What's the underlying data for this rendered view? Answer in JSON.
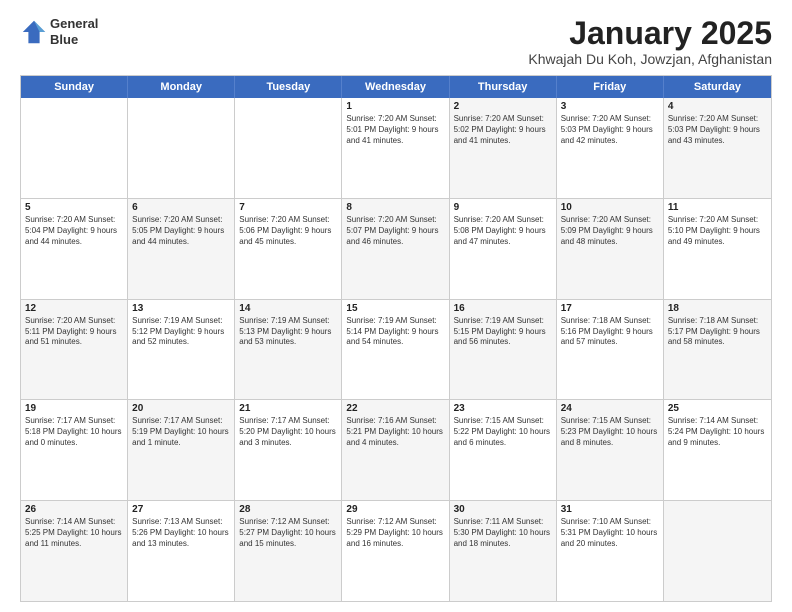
{
  "header": {
    "logo_line1": "General",
    "logo_line2": "Blue",
    "month_title": "January 2025",
    "location": "Khwajah Du Koh, Jowzjan, Afghanistan"
  },
  "days_of_week": [
    "Sunday",
    "Monday",
    "Tuesday",
    "Wednesday",
    "Thursday",
    "Friday",
    "Saturday"
  ],
  "weeks": [
    [
      {
        "day": "",
        "info": "",
        "shaded": false
      },
      {
        "day": "",
        "info": "",
        "shaded": false
      },
      {
        "day": "",
        "info": "",
        "shaded": false
      },
      {
        "day": "1",
        "info": "Sunrise: 7:20 AM\nSunset: 5:01 PM\nDaylight: 9 hours and 41 minutes.",
        "shaded": false
      },
      {
        "day": "2",
        "info": "Sunrise: 7:20 AM\nSunset: 5:02 PM\nDaylight: 9 hours and 41 minutes.",
        "shaded": true
      },
      {
        "day": "3",
        "info": "Sunrise: 7:20 AM\nSunset: 5:03 PM\nDaylight: 9 hours and 42 minutes.",
        "shaded": false
      },
      {
        "day": "4",
        "info": "Sunrise: 7:20 AM\nSunset: 5:03 PM\nDaylight: 9 hours and 43 minutes.",
        "shaded": true
      }
    ],
    [
      {
        "day": "5",
        "info": "Sunrise: 7:20 AM\nSunset: 5:04 PM\nDaylight: 9 hours and 44 minutes.",
        "shaded": false
      },
      {
        "day": "6",
        "info": "Sunrise: 7:20 AM\nSunset: 5:05 PM\nDaylight: 9 hours and 44 minutes.",
        "shaded": true
      },
      {
        "day": "7",
        "info": "Sunrise: 7:20 AM\nSunset: 5:06 PM\nDaylight: 9 hours and 45 minutes.",
        "shaded": false
      },
      {
        "day": "8",
        "info": "Sunrise: 7:20 AM\nSunset: 5:07 PM\nDaylight: 9 hours and 46 minutes.",
        "shaded": true
      },
      {
        "day": "9",
        "info": "Sunrise: 7:20 AM\nSunset: 5:08 PM\nDaylight: 9 hours and 47 minutes.",
        "shaded": false
      },
      {
        "day": "10",
        "info": "Sunrise: 7:20 AM\nSunset: 5:09 PM\nDaylight: 9 hours and 48 minutes.",
        "shaded": true
      },
      {
        "day": "11",
        "info": "Sunrise: 7:20 AM\nSunset: 5:10 PM\nDaylight: 9 hours and 49 minutes.",
        "shaded": false
      }
    ],
    [
      {
        "day": "12",
        "info": "Sunrise: 7:20 AM\nSunset: 5:11 PM\nDaylight: 9 hours and 51 minutes.",
        "shaded": true
      },
      {
        "day": "13",
        "info": "Sunrise: 7:19 AM\nSunset: 5:12 PM\nDaylight: 9 hours and 52 minutes.",
        "shaded": false
      },
      {
        "day": "14",
        "info": "Sunrise: 7:19 AM\nSunset: 5:13 PM\nDaylight: 9 hours and 53 minutes.",
        "shaded": true
      },
      {
        "day": "15",
        "info": "Sunrise: 7:19 AM\nSunset: 5:14 PM\nDaylight: 9 hours and 54 minutes.",
        "shaded": false
      },
      {
        "day": "16",
        "info": "Sunrise: 7:19 AM\nSunset: 5:15 PM\nDaylight: 9 hours and 56 minutes.",
        "shaded": true
      },
      {
        "day": "17",
        "info": "Sunrise: 7:18 AM\nSunset: 5:16 PM\nDaylight: 9 hours and 57 minutes.",
        "shaded": false
      },
      {
        "day": "18",
        "info": "Sunrise: 7:18 AM\nSunset: 5:17 PM\nDaylight: 9 hours and 58 minutes.",
        "shaded": true
      }
    ],
    [
      {
        "day": "19",
        "info": "Sunrise: 7:17 AM\nSunset: 5:18 PM\nDaylight: 10 hours and 0 minutes.",
        "shaded": false
      },
      {
        "day": "20",
        "info": "Sunrise: 7:17 AM\nSunset: 5:19 PM\nDaylight: 10 hours and 1 minute.",
        "shaded": true
      },
      {
        "day": "21",
        "info": "Sunrise: 7:17 AM\nSunset: 5:20 PM\nDaylight: 10 hours and 3 minutes.",
        "shaded": false
      },
      {
        "day": "22",
        "info": "Sunrise: 7:16 AM\nSunset: 5:21 PM\nDaylight: 10 hours and 4 minutes.",
        "shaded": true
      },
      {
        "day": "23",
        "info": "Sunrise: 7:15 AM\nSunset: 5:22 PM\nDaylight: 10 hours and 6 minutes.",
        "shaded": false
      },
      {
        "day": "24",
        "info": "Sunrise: 7:15 AM\nSunset: 5:23 PM\nDaylight: 10 hours and 8 minutes.",
        "shaded": true
      },
      {
        "day": "25",
        "info": "Sunrise: 7:14 AM\nSunset: 5:24 PM\nDaylight: 10 hours and 9 minutes.",
        "shaded": false
      }
    ],
    [
      {
        "day": "26",
        "info": "Sunrise: 7:14 AM\nSunset: 5:25 PM\nDaylight: 10 hours and 11 minutes.",
        "shaded": true
      },
      {
        "day": "27",
        "info": "Sunrise: 7:13 AM\nSunset: 5:26 PM\nDaylight: 10 hours and 13 minutes.",
        "shaded": false
      },
      {
        "day": "28",
        "info": "Sunrise: 7:12 AM\nSunset: 5:27 PM\nDaylight: 10 hours and 15 minutes.",
        "shaded": true
      },
      {
        "day": "29",
        "info": "Sunrise: 7:12 AM\nSunset: 5:29 PM\nDaylight: 10 hours and 16 minutes.",
        "shaded": false
      },
      {
        "day": "30",
        "info": "Sunrise: 7:11 AM\nSunset: 5:30 PM\nDaylight: 10 hours and 18 minutes.",
        "shaded": true
      },
      {
        "day": "31",
        "info": "Sunrise: 7:10 AM\nSunset: 5:31 PM\nDaylight: 10 hours and 20 minutes.",
        "shaded": false
      },
      {
        "day": "",
        "info": "",
        "shaded": true
      }
    ]
  ]
}
